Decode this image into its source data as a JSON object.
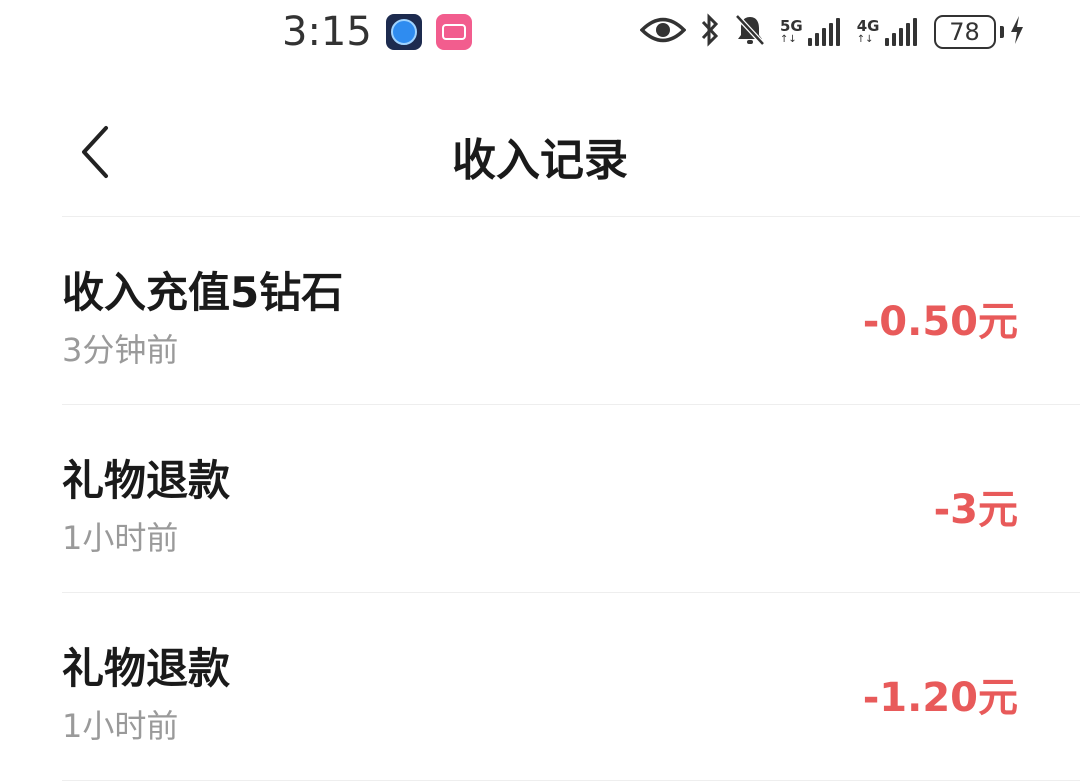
{
  "status_bar": {
    "time": "3:15",
    "battery_level": "78",
    "network_5g": "5G",
    "network_4g": "4G",
    "icons": [
      "app-bot-icon",
      "bilibili-icon",
      "eye-icon",
      "bluetooth-icon",
      "bell-muted-icon",
      "signal-5g-icon",
      "signal-4g-icon",
      "battery-icon",
      "charging-icon"
    ]
  },
  "header": {
    "title": "收入记录",
    "back_icon": "chevron-left-icon"
  },
  "records": [
    {
      "title": "收入充值5钻石",
      "time": "3分钟前",
      "amount": "-0.50元"
    },
    {
      "title": "礼物退款",
      "time": "1小时前",
      "amount": "-3元"
    },
    {
      "title": "礼物退款",
      "time": "1小时前",
      "amount": "-1.20元"
    }
  ],
  "colors": {
    "amount": "#e85a5a",
    "title": "#1a1a1a",
    "subtext": "#9a9a9a",
    "divider": "#eeeeee"
  }
}
